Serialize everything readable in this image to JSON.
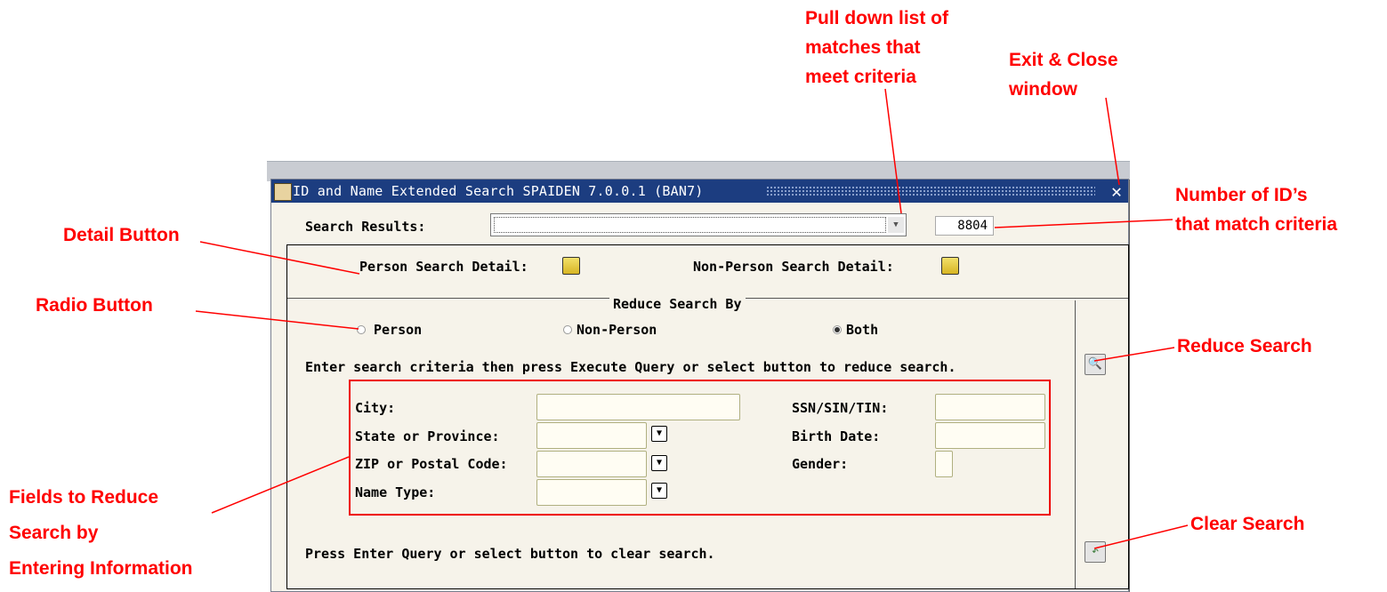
{
  "annotations": {
    "pull_down": [
      "Pull down list of",
      "matches that",
      "meet criteria"
    ],
    "exit_close": [
      "Exit & Close",
      "window"
    ],
    "num_ids": [
      "Number of ID’s",
      "that match criteria"
    ],
    "detail_button": "Detail Button",
    "radio_button": "Radio Button",
    "reduce_search": "Reduce Search",
    "clear_search": "Clear Search",
    "fields": [
      "Fields to Reduce",
      "Search by",
      "Entering Information"
    ]
  },
  "window": {
    "title": "ID and Name Extended Search  SPAIDEN  7.0.0.1  (BAN7)",
    "close_icon": "close-icon",
    "colors": {
      "titlebar": "#1c3d80",
      "annotation": "#ff0000"
    }
  },
  "search_results": {
    "label": "Search Results:",
    "value": "",
    "count": "8804"
  },
  "detail": {
    "person": "Person Search Detail:",
    "non_person": "Non-Person Search Detail:"
  },
  "reduce": {
    "title": "Reduce Search By",
    "options": [
      "Person",
      "Non-Person",
      "Both"
    ],
    "selected": "Both"
  },
  "instructions": {
    "criteria": "Enter search criteria then press Execute Query or select button to reduce search.",
    "clear": "Press Enter Query or select button to clear search."
  },
  "fields": {
    "city": "City:",
    "state": "State or Province:",
    "zip": "ZIP or Postal Code:",
    "name_type": "Name Type:",
    "ssn": "SSN/SIN/TIN:",
    "birth_date": "Birth Date:",
    "gender": "Gender:"
  }
}
